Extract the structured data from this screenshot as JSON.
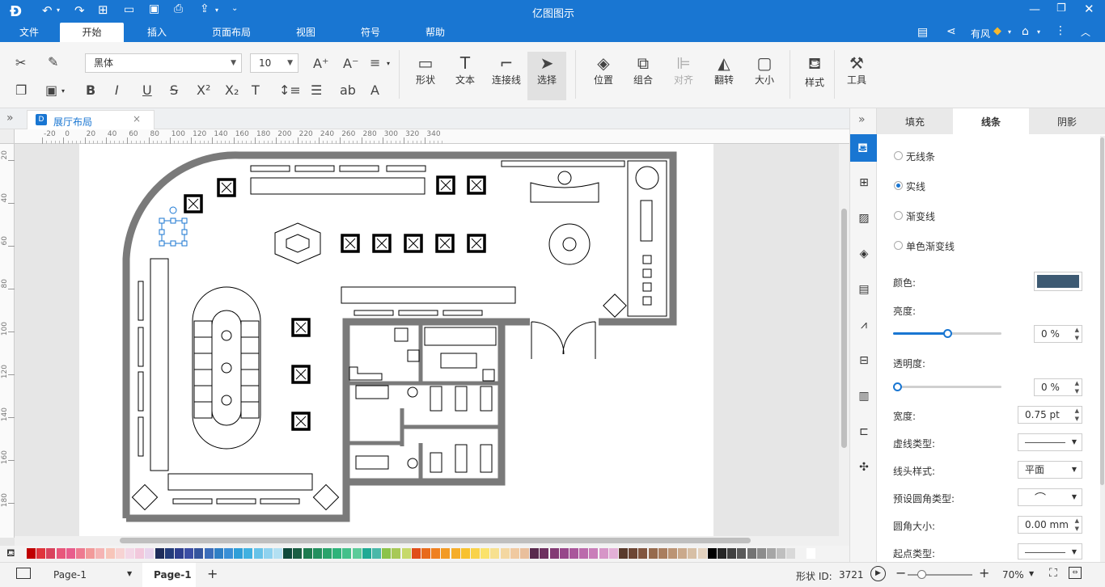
{
  "app": {
    "title": "亿图图示"
  },
  "menu": {
    "items": [
      "文件",
      "开始",
      "插入",
      "页面布局",
      "视图",
      "符号",
      "帮助"
    ],
    "active": "开始"
  },
  "user": {
    "name": "有风"
  },
  "ribbon": {
    "font_name": "黑体",
    "font_size": "10",
    "big_buttons": [
      "形状",
      "文本",
      "连接线",
      "选择",
      "位置",
      "组合",
      "对齐",
      "翻转",
      "大小",
      "样式",
      "工具"
    ]
  },
  "document_tab": {
    "label": "展厅布局"
  },
  "ruler": {
    "h_ticks": [
      "-20",
      "0",
      "20",
      "40",
      "60",
      "80",
      "100",
      "120",
      "140",
      "160",
      "180",
      "200",
      "220",
      "240",
      "260",
      "280",
      "300",
      "320",
      "340"
    ],
    "v_ticks": [
      "20",
      "40",
      "60",
      "80",
      "100",
      "120",
      "140",
      "160",
      "180"
    ]
  },
  "panel": {
    "tabs": [
      "填充",
      "线条",
      "阴影"
    ],
    "active_tab": "线条",
    "line_options": [
      "无线条",
      "实线",
      "渐变线",
      "单色渐变线"
    ],
    "selected_option": "实线",
    "color_label": "颜色:",
    "color_value": "#3d5a73",
    "brightness_label": "亮度:",
    "brightness_value": "0 %",
    "brightness_level": 0.5,
    "transparency_label": "透明度:",
    "transparency_value": "0 %",
    "transparency_level": 0,
    "width_label": "宽度:",
    "width_value": "0.75 pt",
    "dash_label": "虚线类型:",
    "cap_label": "线头样式:",
    "cap_value": "平面",
    "corner_type_label": "预设圆角类型:",
    "corner_size_label": "圆角大小:",
    "corner_size_value": "0.00 mm",
    "start_type_label": "起点类型:"
  },
  "status": {
    "page_selector": "Page-1",
    "page_tab": "Page-1",
    "shape_id_label": "形状 ID:",
    "shape_id_value": "3721",
    "zoom": "70%"
  },
  "colors": {
    "accent": "#1976d2",
    "palette": [
      "#c00000",
      "#e0343c",
      "#d9435d",
      "#e8577b",
      "#e85d8c",
      "#ee7a90",
      "#f29a9a",
      "#f5b4b4",
      "#f7c5b9",
      "#f7d3d3",
      "#f3d7e6",
      "#f2c8dc",
      "#e8d4ec",
      "#1f2d5b",
      "#243c7a",
      "#2e3f8e",
      "#3b4ea4",
      "#35559d",
      "#3b6dba",
      "#2f7fc5",
      "#3a8fd6",
      "#2f9ed8",
      "#40b0e0",
      "#67c2e8",
      "#8fd2ef",
      "#b3e0f2",
      "#0f4a3c",
      "#1b5e43",
      "#1e7b4f",
      "#238f5e",
      "#2aa36b",
      "#2fb37a",
      "#44c08a",
      "#5ccb9a",
      "#1faa94",
      "#4ab8a9",
      "#8bc34a",
      "#a7c957",
      "#c6d96a",
      "#e04e1a",
      "#e86a1c",
      "#ef8020",
      "#f29a24",
      "#f5ad2a",
      "#f8c12e",
      "#f9d24a",
      "#fbe26b",
      "#f7e08f",
      "#f4d7a1",
      "#f0c9a0",
      "#e9bf9c",
      "#5a2a4e",
      "#6e3160",
      "#833a74",
      "#97468a",
      "#a9569b",
      "#bb6aac",
      "#c97eb9",
      "#d695c7",
      "#e3b0d7",
      "#5a3a2c",
      "#6d4634",
      "#82563f",
      "#966a4d",
      "#a97e5f",
      "#bb9474",
      "#caa98b",
      "#d7bfa5",
      "#e3d2bf",
      "#000000",
      "#262626",
      "#404040",
      "#595959",
      "#737373",
      "#8c8c8c",
      "#a6a6a6",
      "#bfbfbf",
      "#d9d9d9",
      "#f2f2f2",
      "#ffffff"
    ]
  }
}
